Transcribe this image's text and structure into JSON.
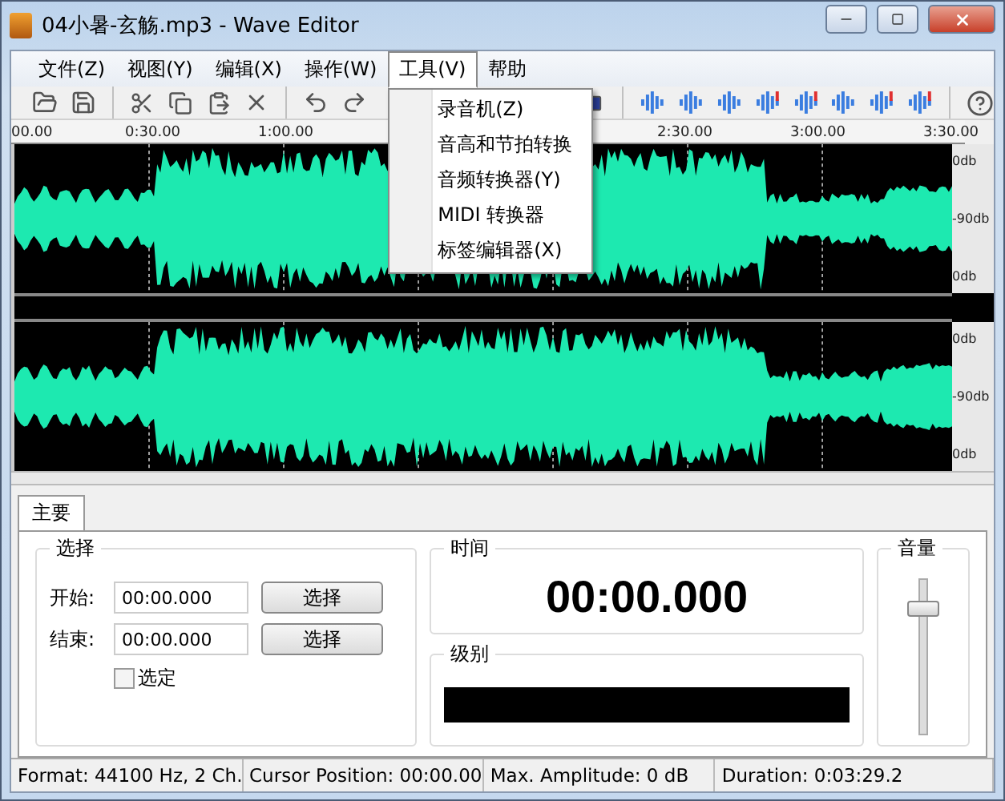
{
  "window": {
    "title": "04小暑-玄觞.mp3 - Wave Editor"
  },
  "menu": [
    {
      "label": "文件(Z)",
      "selected": false
    },
    {
      "label": "视图(Y)",
      "selected": false
    },
    {
      "label": "编辑(X)",
      "selected": false
    },
    {
      "label": "操作(W)",
      "selected": false
    },
    {
      "label": "工具(V)",
      "selected": true
    },
    {
      "label": "帮助",
      "selected": false
    }
  ],
  "dropdown": {
    "items": [
      "录音机(Z)",
      "音高和节拍转换",
      "音频转换器(Y)",
      "MIDI 转换器",
      "标签编辑器(X)"
    ]
  },
  "ruler": {
    "labels": [
      "00.00",
      "0:30.00",
      "1:00.00",
      "2:30.00",
      "3:00.00",
      "3:30.00"
    ]
  },
  "channels": [
    {
      "db_labels": [
        "0db",
        "-90db",
        "0db"
      ]
    },
    {
      "db_labels": [
        "0db",
        "-90db",
        "0db"
      ]
    }
  ],
  "panel": {
    "tabs": [
      {
        "label": "主要",
        "selected": true
      }
    ],
    "selection": {
      "title": "选择",
      "rows": [
        {
          "label": "开始:",
          "value": "00:00.000",
          "button": "选择"
        },
        {
          "label": "结束:",
          "value": "00:00.000",
          "button": "选择"
        }
      ],
      "checkbox": {
        "label": "选定",
        "checked": false
      }
    },
    "time": {
      "title": "时间",
      "value": "00:00.000"
    },
    "level": {
      "title": "级别"
    },
    "volume": {
      "title": "音量",
      "level": 0.85
    }
  },
  "status_bar": [
    "Format: 44100 Hz, 2 Ch.",
    "Cursor Position: 00:00.00",
    "Max. Amplitude: 0 dB",
    "Duration: 0:03:29.2"
  ]
}
